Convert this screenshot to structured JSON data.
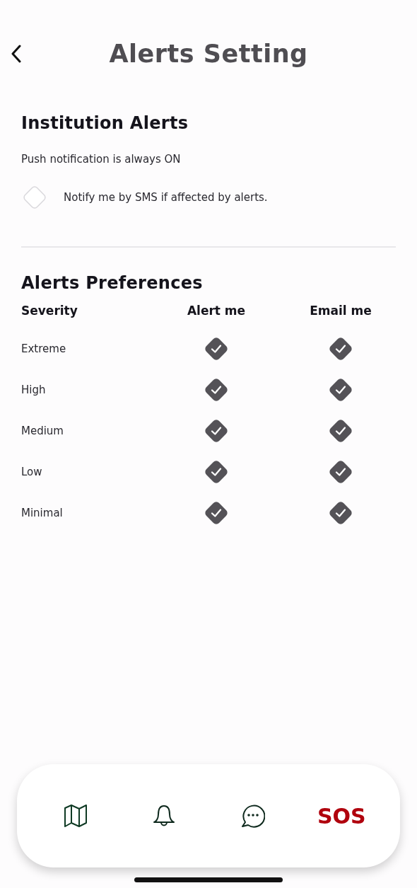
{
  "header": {
    "title": "Alerts Setting"
  },
  "institution_alerts": {
    "heading": "Institution Alerts",
    "note": "Push notification is always ON",
    "sms_option": {
      "label": "Notify me by SMS if affected by alerts.",
      "checked": false
    }
  },
  "preferences": {
    "heading": "Alerts Preferences",
    "columns": [
      "Severity",
      "Alert me",
      "Email me"
    ],
    "rows": [
      {
        "severity": "Extreme",
        "alert_me": true,
        "email_me": true
      },
      {
        "severity": "High",
        "alert_me": true,
        "email_me": true
      },
      {
        "severity": "Medium",
        "alert_me": true,
        "email_me": true
      },
      {
        "severity": "Low",
        "alert_me": true,
        "email_me": true
      },
      {
        "severity": "Minimal",
        "alert_me": true,
        "email_me": true
      }
    ]
  },
  "bottom_nav": [
    {
      "kind": "map"
    },
    {
      "kind": "bell"
    },
    {
      "kind": "chat"
    },
    {
      "kind": "text",
      "label": "SOS"
    }
  ]
}
